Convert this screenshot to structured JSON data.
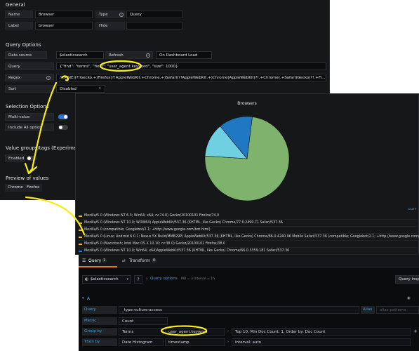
{
  "general": {
    "title": "General",
    "name_label": "Name",
    "name_value": "Browser",
    "type_label": "Type",
    "type_value": "Query",
    "label_label": "Label",
    "label_value": "browser",
    "hide_label": "Hide",
    "hide_value": ""
  },
  "query_options": {
    "title": "Query Options",
    "datasource_label": "Data source",
    "datasource_value": "$elasticsearch",
    "refresh_label": "Refresh",
    "refresh_value": "On Dashboard Load",
    "query_label": "Query",
    "query_value": "{\"find\": \"terms\", \"field\": \"user_agent.keyword\", \"size\": 1000}",
    "regex_label": "Regex",
    "regex_value": "/((MSIE)(?!Gecko.+)Firefox(?!AppleWebKit.+Chrome.+)Safari(?!AppleWebKit.+)Chrome(AppleWebKit(?!.+Chrome(.+Safari)Gecko(?!.+Fi...",
    "sort_label": "Sort",
    "sort_value": "Disabled"
  },
  "selection_options": {
    "title": "Selection Options",
    "multi_value_label": "Multi-value",
    "multi_value_on": true,
    "include_all_label": "Include All option",
    "include_all_on": false
  },
  "value_groups": {
    "title": "Value groups/tags (Experimental)",
    "enabled_label": "Enabled"
  },
  "preview": {
    "title": "Preview of values",
    "values": [
      "Chrome",
      "Firefox"
    ]
  },
  "chart_panel": {
    "title": "Browsers",
    "more_link": "curr"
  },
  "chart_data": {
    "type": "pie",
    "title": "Browsers",
    "slices": [
      {
        "label": "Mozilla/5.0 (Windows NT 6.3; Win64; x64; rv:74.0) Gecko/20100101 Firefox/74.0",
        "value": 74,
        "color": "#7eb26d"
      },
      {
        "label": "Mozilla/5.0 (Windows NT 10.0; WOW64) AppleWebKit/537.36 (KHTML, like Gecko) Chrome/77.0.2490.71 Safari/537.36",
        "value": 13,
        "color": "#6ed0e0"
      },
      {
        "label": "Mozilla/5.0 (compatible; Googlebot/2.1; +http://www.google.com/bot.html)",
        "value": 13,
        "color": "#1f78c1"
      }
    ]
  },
  "legend": [
    {
      "text": "Mozilla/5.0 (Windows NT 6.3; Win64; x64; rv:74.0) Gecko/20100101 Firefox/74.0",
      "color": "#eab839"
    },
    {
      "text": "Mozilla/5.0 (Windows NT 10.0; WOW64) AppleWebKit/537.36 (KHTML, like Gecko) Chrome/77.0.2490.71 Safari/537.36",
      "color": "#eab839"
    },
    {
      "text": "Mozilla/5.0 (compatible; Googlebot/2.1; +http://www.google.com/bot.html)",
      "color": "#eab839"
    },
    {
      "text": "Mozilla/5.0 (Linux; Android 6.0.1; Nexus 5X Build/MMB29P) AppleWebKit/537.36 (KHTML, like Gecko) Chrome/86.0.4240.96 Mobile Safari/537.36 (compatible; Googlebot/2.1; +http://www.google.com/...",
      "color": "#eab839"
    },
    {
      "text": "Mozilla/5.0 (Macintosh; Intel Mac OS X 10.10; rv:38.0) Gecko/20100101 Firefox/38.0",
      "color": "#eab839"
    },
    {
      "text": "Mozilla/5.0 (Windows NT 10.0; Win64; x64)AppleWebKit/537.36 (KHTML, like Gecko) Chrome/66.0.3359.181 Safari/537.36",
      "color": "#1f78c1"
    }
  ],
  "query_editor": {
    "tab_query": "Query",
    "tab_query_count": "1",
    "tab_transform": "Transform",
    "tab_transform_count": "0",
    "datasource": "$elasticsearch",
    "query_options_label": "Query options",
    "query_options_meta": "MD = 3   Interval = 1h",
    "query_inspector": "Query inspe",
    "ref_id": "A",
    "query_label": "Query",
    "query_value": "_type:vulture-access",
    "alias_label": "Alias",
    "alias_placeholder": "alias patterns",
    "metric_label": "Metric",
    "metric_value": "Count",
    "group_by_label": "Group by",
    "group_by_type": "Terms",
    "group_by_field": "user_agent.keyword",
    "group_by_options": "Top 10, Min Doc Count: 1, Order by: Doc Count",
    "then_by_label": "Then by",
    "then_by_type": "Date Histogram",
    "then_by_field": "timestamp",
    "then_by_options": "Interval: auto"
  },
  "colors": {
    "accent": "#3274d9",
    "highlight": "#f5ec1a"
  }
}
